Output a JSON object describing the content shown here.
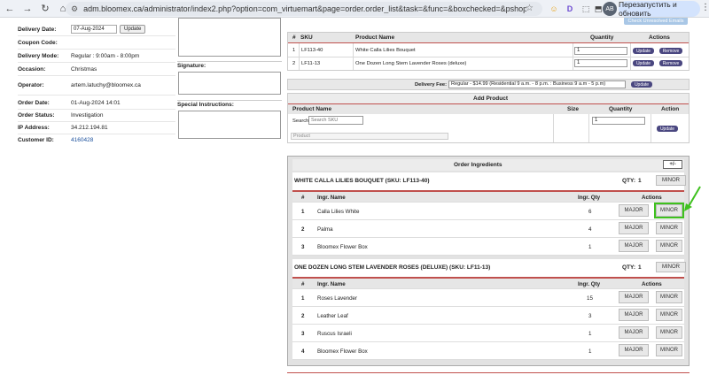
{
  "browser": {
    "url": "adm.bloomex.ca/administrator/index2.php?option=com_virtuemart&page=order.order_list&task=&func=&boxchecked=&pshop_mode=admin&order_id...",
    "relaunch_label": "Перезапустить и обновить",
    "avatar": "AB",
    "nav": {
      "back": "←",
      "forward": "→",
      "reload": "↻",
      "home": "⌂"
    },
    "ext": [
      "☺",
      "D",
      "⬚",
      "⬒"
    ],
    "star": "☆",
    "tune": "⚙",
    "kebab": "⋮"
  },
  "order": {
    "delivery_date_label": "Delivery Date:",
    "delivery_date_value": "07-Aug-2024",
    "update_label": "Update",
    "coupon_label": "Coupon Code:",
    "coupon_value": "",
    "delivery_mode_label": "Delivery Mode:",
    "delivery_mode_value": "Regular : 9:00am - 8:00pm",
    "occasion_label": "Occasion:",
    "occasion_value": "Christmas",
    "operator_label": "Operator:",
    "operator_value": "artem.latuchy@bloomex.ca",
    "order_date_label": "Order Date:",
    "order_date_value": "01-Aug-2024 14:01",
    "order_status_label": "Order Status:",
    "order_status_value": "Investigation",
    "ip_label": "IP Address:",
    "ip_value": "34.212.194.81",
    "customer_id_label": "Customer ID:",
    "customer_id_value": "4160428",
    "signature_label": "Signature:",
    "special_label": "Special Instructions:"
  },
  "products": {
    "headers": {
      "hash": "#",
      "sku": "SKU",
      "name": "Product Name",
      "qty": "Quantity",
      "actions": "Actions"
    },
    "update_label": "Update",
    "remove_label": "Remove",
    "rows": [
      {
        "num": "1",
        "sku": "LF113-40",
        "name": "White Calla Lilies Bouquet",
        "qty": "1"
      },
      {
        "num": "2",
        "sku": "LF11-13",
        "name": "One Dozen Long Stem Lavender Roses (deluxe)",
        "qty": "1"
      }
    ],
    "delivery_fee_label": "Delivery Fee:",
    "delivery_fee_value": "Regular - $14.99 (Residential 9 a.m. - 8 p.m. : Business 9 a.m - 5 p.m)",
    "delivery_update": "Update"
  },
  "add_product": {
    "title": "Add Product",
    "headers": {
      "name": "Product Name",
      "size": "Size",
      "qty": "Quantity",
      "action": "Action"
    },
    "search_label": "Search:",
    "search_placeholder": "Search SKU",
    "qty_value": "1",
    "product_placeholder": "Product",
    "update_label": "Update"
  },
  "ingredients": {
    "title": "Order Ingredients",
    "toggle": "+/-",
    "groups": [
      {
        "title": "WHITE CALLA LILIES BOUQUET (SKU: LF113-40)",
        "qty_label": "QTY:",
        "qty": "1",
        "minor": "MINOR",
        "headers": {
          "num": "#",
          "name": "Ingr. Name",
          "qty": "Ingr. Qty",
          "actions": "Actions"
        },
        "rows": [
          {
            "num": "1",
            "name": "Calla Lilies White",
            "qty": "6",
            "major": "MAJOR",
            "minor": "MINOR"
          },
          {
            "num": "2",
            "name": "Palma",
            "qty": "4",
            "major": "MAJOR",
            "minor": "MINOR"
          },
          {
            "num": "3",
            "name": "Bloomex Flower Box",
            "qty": "1",
            "major": "MAJOR",
            "minor": "MINOR"
          }
        ]
      },
      {
        "title": "ONE DOZEN LONG STEM LAVENDER ROSES (DELUXE) (SKU: LF11-13)",
        "qty_label": "QTY:",
        "qty": "1",
        "minor": "MINOR",
        "headers": {
          "num": "#",
          "name": "Ingr. Name",
          "qty": "Ingr. Qty",
          "actions": "Actions"
        },
        "rows": [
          {
            "num": "1",
            "name": "Roses Lavender",
            "qty": "15",
            "major": "MAJOR",
            "minor": "MINOR"
          },
          {
            "num": "2",
            "name": "Leather Leaf",
            "qty": "3",
            "major": "MAJOR",
            "minor": "MINOR"
          },
          {
            "num": "3",
            "name": "Ruscus Israeli",
            "qty": "1",
            "major": "MAJOR",
            "minor": "MINOR"
          },
          {
            "num": "4",
            "name": "Bloomex Flower Box",
            "qty": "1",
            "major": "MAJOR",
            "minor": "MINOR"
          }
        ]
      }
    ]
  },
  "top_button": "Check Unresolved Emails"
}
